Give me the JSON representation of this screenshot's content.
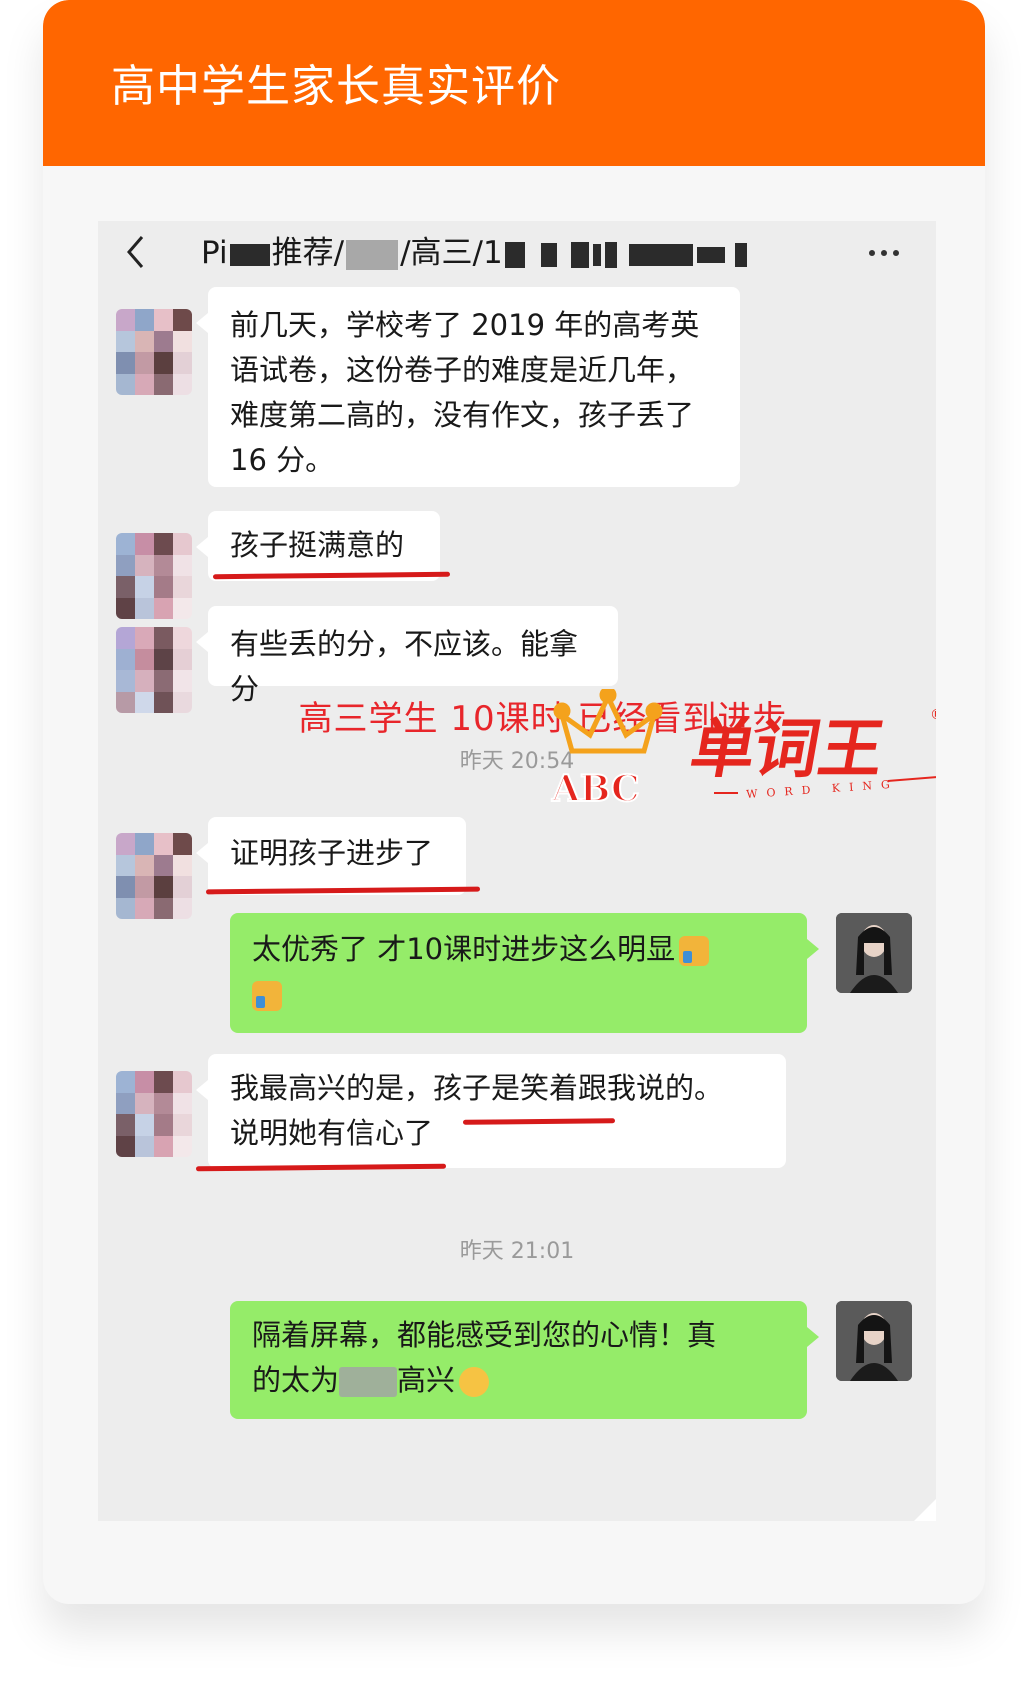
{
  "header": {
    "title": "高中学生家长真实评价"
  },
  "chat": {
    "title_prefix": "Pi",
    "title_mid1": "推荐/",
    "title_mid2": "/高三/1",
    "messages": [
      {
        "id": "m1",
        "side": "left",
        "text": "前几天，学校考了 2019 年的高考英语试卷，这份卷子的难度是近几年，难度第二高的，没有作文，孩子丢了 16 分。"
      },
      {
        "id": "m2",
        "side": "left",
        "text": "孩子挺满意的"
      },
      {
        "id": "m3",
        "side": "left",
        "text": "有些丢的分，不应该。能拿分"
      },
      {
        "id": "m4",
        "side": "left",
        "text": "证明孩子进步了"
      },
      {
        "id": "m5",
        "side": "right",
        "text": "太优秀了 才10课时进步这么明显"
      },
      {
        "id": "m6",
        "side": "left",
        "line1": "我最高兴的是，孩子是笑着跟我说的。",
        "line2": "说明她有信心了"
      },
      {
        "id": "m7",
        "side": "right",
        "line1": "隔着屏幕，都能感受到您的心情！真",
        "line2a": "的太为",
        "line2b": "高兴"
      }
    ],
    "annotation": "高三学生  10课时 已经看到进步",
    "timestamps": [
      "昨天 20:54",
      "昨天 21:01"
    ]
  },
  "watermark": {
    "brand": "单词王",
    "abc": "ABC",
    "sub": "WORD KING",
    "registered": "®"
  },
  "colors": {
    "header_orange": "#ff6600",
    "wechat_green": "#95ec69",
    "annotation_red": "#e8262b",
    "brand_orange": "#f7921e",
    "brand_red": "#e5261e"
  },
  "icons": [
    "back-chevron-icon",
    "more-dots-icon",
    "thumbs-up-icon",
    "emoji-icon",
    "crown-logo-icon"
  ]
}
